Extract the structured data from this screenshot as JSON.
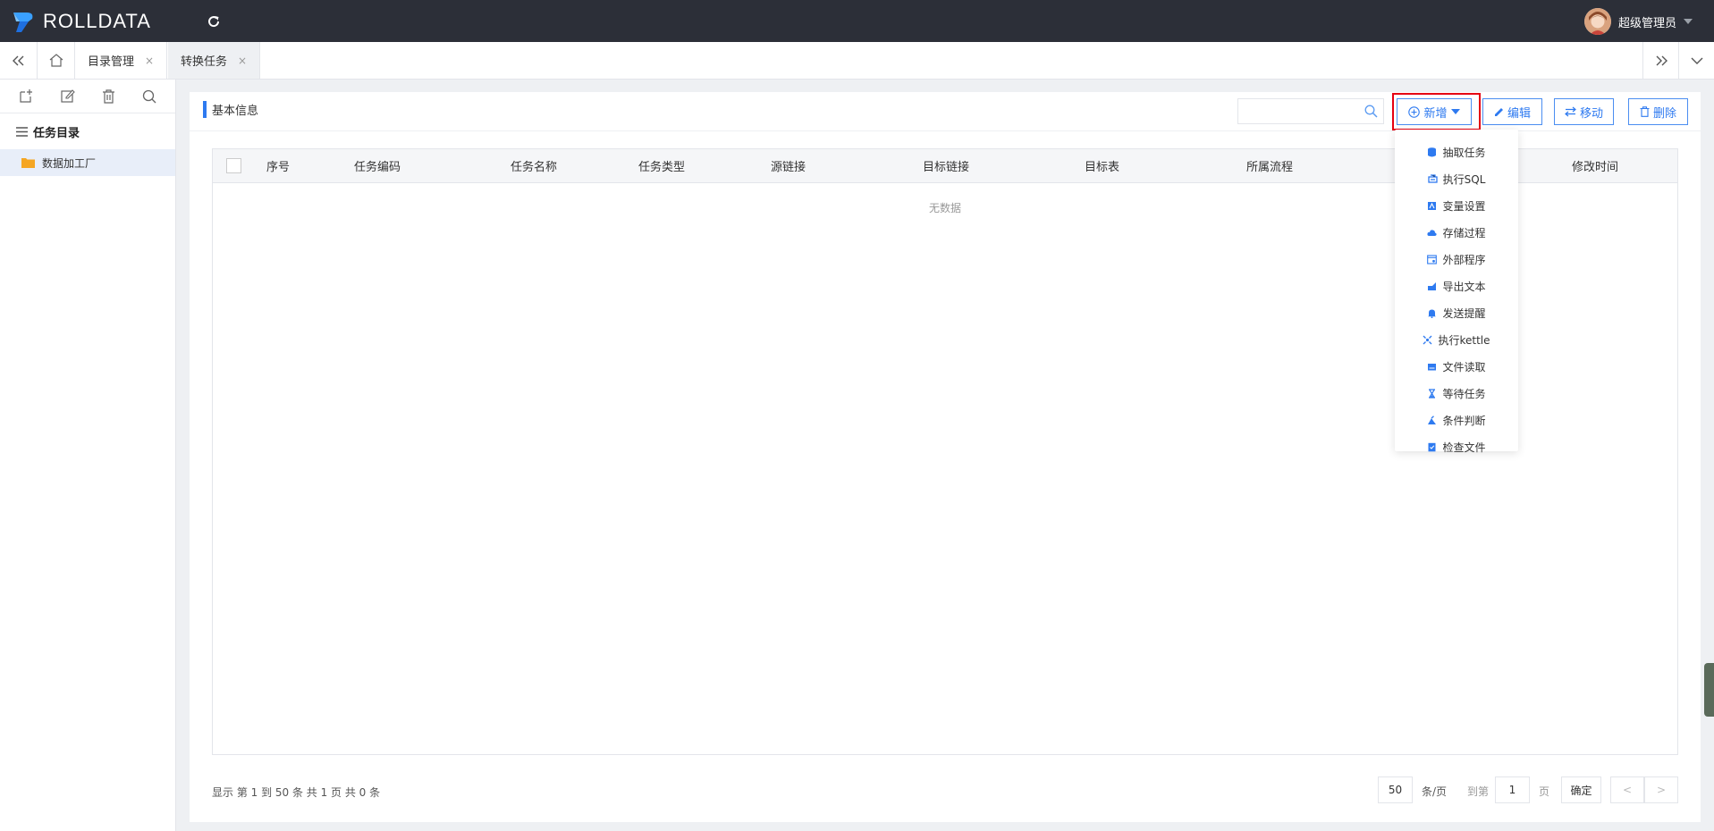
{
  "app": {
    "logo_text": "ROLLDATA"
  },
  "user": {
    "name": "超级管理员"
  },
  "tabs": [
    {
      "label": "目录管理",
      "close": "×"
    },
    {
      "label": "转换任务",
      "close": "×"
    }
  ],
  "sidebar": {
    "tree_title": "任务目录",
    "nodes": [
      {
        "label": "数据加工厂"
      }
    ]
  },
  "panel": {
    "title": "基本信息",
    "search": {
      "placeholder": "",
      "value": ""
    },
    "buttons": {
      "new": "新增",
      "edit": "编辑",
      "move": "移动",
      "delete": "删除"
    }
  },
  "table": {
    "columns": [
      "序号",
      "任务编码",
      "任务名称",
      "任务类型",
      "源链接",
      "目标链接",
      "目标表",
      "所属流程",
      "修改时间"
    ],
    "empty_text": "无数据"
  },
  "pagination": {
    "info": "显示 第 1 到 50 条 共 1 页 共 0 条",
    "page_size": "50",
    "page_size_unit": "条/页",
    "goto_label": "到第",
    "page_input": "1",
    "page_unit": "页",
    "confirm": "确定",
    "prev": "<",
    "next": ">"
  },
  "dropdown": {
    "items": [
      {
        "label": "抽取任务",
        "icon": "database-icon"
      },
      {
        "label": "执行SQL",
        "icon": "sql-icon"
      },
      {
        "label": "变量设置",
        "icon": "variable-icon"
      },
      {
        "label": "存储过程",
        "icon": "cloud-icon"
      },
      {
        "label": "外部程序",
        "icon": "window-icon"
      },
      {
        "label": "导出文本",
        "icon": "export-icon"
      },
      {
        "label": "发送提醒",
        "icon": "bell-icon"
      },
      {
        "label": "执行kettle",
        "icon": "kettle-icon"
      },
      {
        "label": "文件读取",
        "icon": "file-read-icon"
      },
      {
        "label": "等待任务",
        "icon": "hourglass-icon"
      },
      {
        "label": "条件判断",
        "icon": "condition-icon"
      },
      {
        "label": "检查文件",
        "icon": "check-file-icon"
      }
    ]
  },
  "colors": {
    "accent": "#2e7af0",
    "topbar": "#2c2f38",
    "highlight": "#e60012",
    "folder": "#f5a623"
  }
}
